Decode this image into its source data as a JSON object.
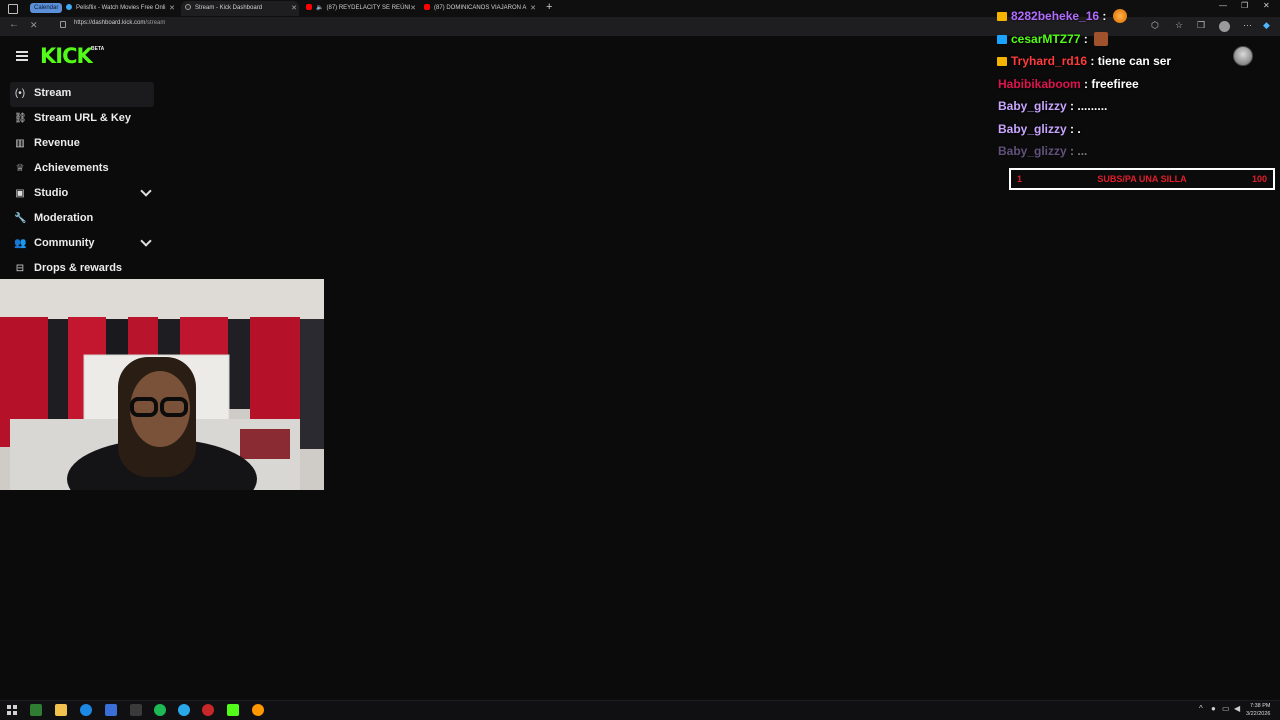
{
  "browser": {
    "tab_group_label": "Calendar",
    "tabs": [
      {
        "title": "Pelisflix - Watch Movies Free Onli"
      },
      {
        "title": "Stream - Kick Dashboard"
      },
      {
        "title": "(87) REYDELACITY SE REÚNI"
      },
      {
        "title": "(87) DOMINICANOS VIAJARON A"
      }
    ],
    "url_host": "https://dashboard.kick.com",
    "url_path": "/stream"
  },
  "app": {
    "logo_text": "KICK",
    "logo_badge": "BETA",
    "brand_color": "#53fc18"
  },
  "sidebar": {
    "items": [
      {
        "label": "Stream",
        "icon": "stream-icon"
      },
      {
        "label": "Stream URL & Key",
        "icon": "link-icon"
      },
      {
        "label": "Revenue",
        "icon": "chart-icon"
      },
      {
        "label": "Achievements",
        "icon": "trophy-icon"
      },
      {
        "label": "Studio",
        "icon": "studio-icon"
      },
      {
        "label": "Moderation",
        "icon": "wrench-icon"
      },
      {
        "label": "Community",
        "icon": "community-icon"
      },
      {
        "label": "Drops & rewards",
        "icon": "gift-icon"
      }
    ]
  },
  "chat": {
    "messages": [
      {
        "user": "8282beheke_16",
        "text": ":",
        "user_color": "#b16cff",
        "badge_color": "#f5b400"
      },
      {
        "user": "cesarMTZ77",
        "text": ":",
        "user_color": "#53fc18",
        "badge_color": "#1aa3ff"
      },
      {
        "user": "Tryhard_rd16",
        "text": ": tiene can ser",
        "user_color": "#ff3b3b",
        "badge_color": "#f5b400"
      },
      {
        "user": "Habibikaboom",
        "text": ": freefiree",
        "user_color": "#e0134f",
        "badge_color": ""
      },
      {
        "user": "Baby_glizzy",
        "text": ": .........",
        "user_color": "#c9a6ff",
        "badge_color": ""
      },
      {
        "user": "Baby_glizzy",
        "text": ": .",
        "user_color": "#c9a6ff",
        "badge_color": ""
      },
      {
        "user": "Baby_glizzy",
        "text": ": ...",
        "user_color": "#c9a6ff",
        "badge_color": ""
      }
    ]
  },
  "sub_goal": {
    "current": "1",
    "label": "SUBS/PA UNA SILLA",
    "goal": "100"
  },
  "taskbar": {
    "time": "7:38 PM",
    "date": "3/22/2026"
  }
}
